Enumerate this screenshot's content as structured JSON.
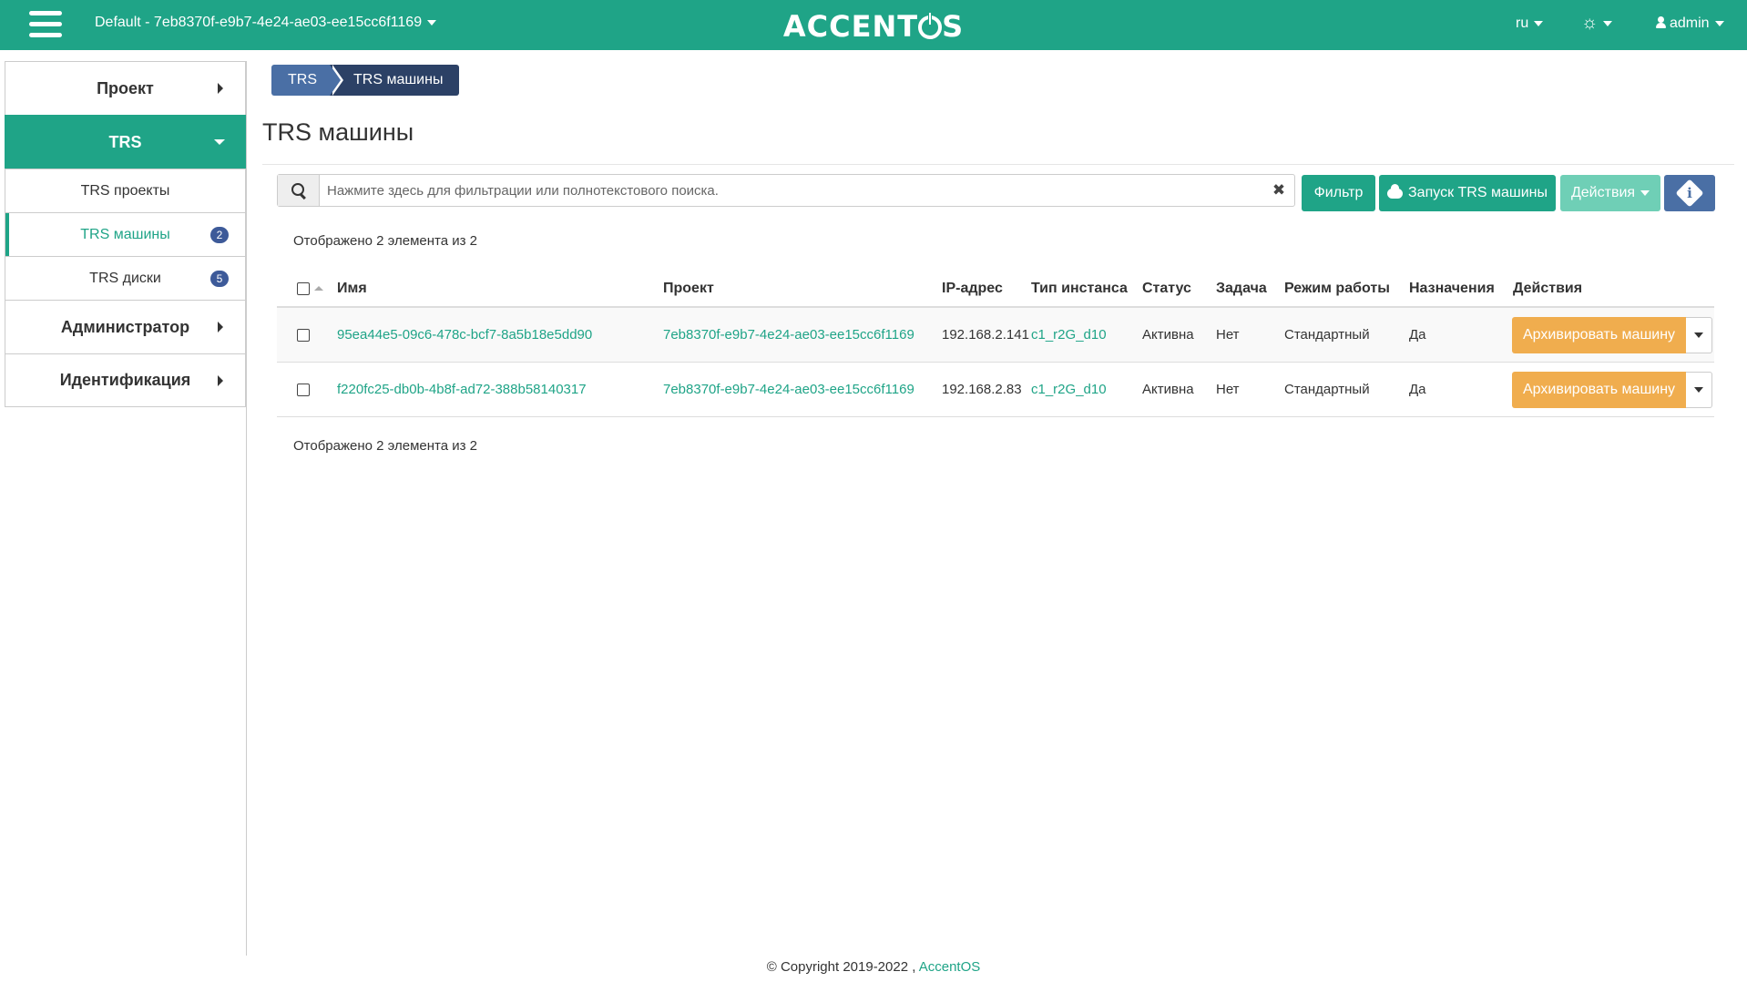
{
  "topbar": {
    "project": "Default - 7eb8370f-e9b7-4e24-ae03-ee15cc6f1169",
    "logo_left": "ACCENT",
    "logo_right": "S",
    "lang": "ru",
    "user": "admin"
  },
  "sidebar": {
    "items": [
      {
        "label": "Проект"
      },
      {
        "label": "TRS"
      },
      {
        "label": "Администратор"
      },
      {
        "label": "Идентификация"
      }
    ],
    "sub": [
      {
        "label": "TRS проекты"
      },
      {
        "label": "TRS машины",
        "badge": "2"
      },
      {
        "label": "TRS диски",
        "badge": "5"
      }
    ]
  },
  "breadcrumb": [
    "TRS",
    "TRS машины"
  ],
  "page_title": "TRS машины",
  "search": {
    "placeholder": "Нажмите здесь для фильтрации или полнотекстового поиска."
  },
  "toolbar": {
    "filter": "Фильтр",
    "launch": "Запуск TRS машины",
    "actions": "Действия"
  },
  "count_text": "Отображено 2 элемента из 2",
  "table": {
    "headers": [
      "Имя",
      "Проект",
      "IP-адрес",
      "Тип инстанса",
      "Статус",
      "Задача",
      "Режим работы",
      "Назначения",
      "Действия"
    ],
    "rows": [
      {
        "name": "95ea44e5-09c6-478c-bcf7-8a5b18e5dd90",
        "project": "7eb8370f-e9b7-4e24-ae03-ee15cc6f1169",
        "ip": "192.168.2.141",
        "flavor": "c1_r2G_d10",
        "status": "Активна",
        "task": "Нет",
        "mode": "Стандартный",
        "assigned": "Да",
        "action": "Архивировать машину"
      },
      {
        "name": "f220fc25-db0b-4b8f-ad72-388b58140317",
        "project": "7eb8370f-e9b7-4e24-ae03-ee15cc6f1169",
        "ip": "192.168.2.83",
        "flavor": "c1_r2G_d10",
        "status": "Активна",
        "task": "Нет",
        "mode": "Стандартный",
        "assigned": "Да",
        "action": "Архивировать машину"
      }
    ]
  },
  "footer": {
    "copyright": "© Copyright 2019-2022 ,",
    "link": "AccentOS"
  },
  "colors": {
    "brand": "#1fa487",
    "breadcrumb_dark": "#2c4166",
    "archive_button": "#f0ad4e"
  }
}
